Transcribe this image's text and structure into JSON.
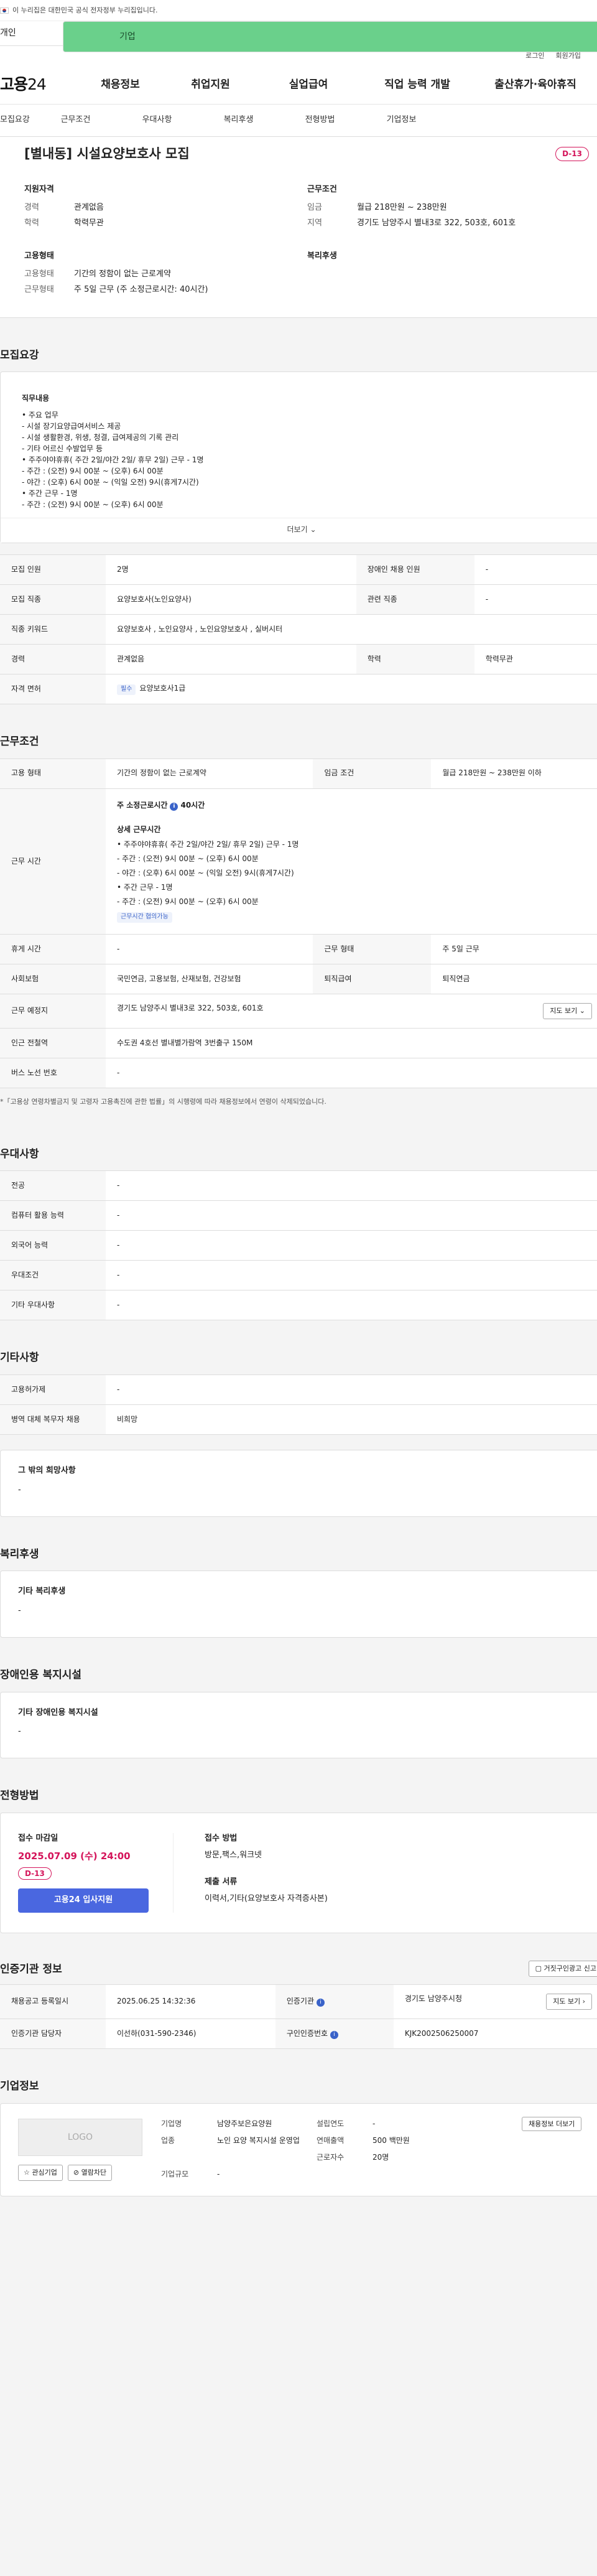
{
  "gov_banner": "이 누리집은 대한민국 공식 전자정부 누리집입니다.",
  "user_tabs": {
    "person": "개인",
    "company": "기업"
  },
  "util": {
    "login": "로그인",
    "signup": "회원가입"
  },
  "gnb": {
    "logo_main": "고용",
    "logo_num": "24",
    "items": [
      "채용정보",
      "취업지원",
      "실업급여",
      "직업 능력 개발",
      "출산휴가·육아휴직"
    ]
  },
  "subtabs": [
    "모집요강",
    "근무조건",
    "우대사항",
    "복리후생",
    "전형방법",
    "기업정보"
  ],
  "summary": {
    "title": "[별내동] 시설요양보호사 모집",
    "dday": "D-13",
    "qual": {
      "label": "지원자격",
      "career_k": "경력",
      "career_v": "관계없음",
      "edu_k": "학력",
      "edu_v": "학력무관"
    },
    "cond": {
      "label": "근무조건",
      "wage_k": "임금",
      "wage_v": "월급 218만원 ~ 238만원",
      "area_k": "지역",
      "area_v": "경기도 남양주시 별내3로 322, 503호, 601호"
    },
    "emp": {
      "label": "고용형태",
      "type_k": "고용형태",
      "type_v": "기간의 정함이 없는 근로계약",
      "work_k": "근무형태",
      "work_v": "주 5일 근무 (주 소정근로시간: 40시간)"
    },
    "welfare": {
      "label": "복리후생"
    }
  },
  "recruit": {
    "title": "모집요강",
    "duty_title": "직무내용",
    "duty_lines": "• 주요 업무\n   - 시설 장기요양급여서비스 제공\n   - 시설 생활환경, 위생, 청결, 급여제공의 기록 관리\n   - 기타 어르신 수발업무 등\n• 주주야야휴휴( 주간 2일/야간 2일/ 휴무 2일) 근무 - 1명\n   - 주간 : (오전) 9시 00분 ~ (오후) 6시 00분\n   - 야간 : (오후) 6시 00분 ~ (익일 오전) 9시(휴게7시간)\n• 주간 근무 - 1명\n   - 주간 : (오전) 9시 00분 ~ (오후) 6시 00분",
    "more": "더보기",
    "rows": {
      "count_k": "모집 인원",
      "count_v": "2명",
      "disabled_k": "장애인 채용 인원",
      "disabled_v": "-",
      "job_k": "모집 직종",
      "job_v": "요양보호사(노인요양사)",
      "rel_k": "관련 직종",
      "rel_v": "-",
      "kw_k": "직종 키워드",
      "kw_v": "요양보호사 , 노인요양사 , 노인요양보호사 , 실버시터",
      "career_k": "경력",
      "career_v": "관계없음",
      "edu_k": "학력",
      "edu_v": "학력무관",
      "license_k": "자격 면허",
      "license_tag": "필수",
      "license_v": "요양보호사1급"
    }
  },
  "work": {
    "title": "근무조건",
    "type_k": "고용 형태",
    "type_v": "기간의 정함이 없는 근로계약",
    "wage_k": "임금 조건",
    "wage_v": "월급 218만원 ~ 238만원 이하",
    "hours_k": "근무 시간",
    "hours_head": "주 소정근로시간",
    "hours_val": "40시간",
    "detail_title": "상세 근무시간",
    "detail_lines": "• 주주야야휴휴( 주간 2일/야간 2일/ 휴무 2일) 근무 - 1명\n      - 주간 : (오전) 9시 00분 ~ (오후) 6시 00분\n      - 야간 : (오후) 6시 00분 ~ (익일 오전) 9시(휴게7시간)\n• 주간 근무 - 1명\n      - 주간 : (오전) 9시 00분 ~ (오후) 6시 00분",
    "flex_tag": "근무시간 협의가능",
    "break_k": "휴게 시간",
    "break_v": "-",
    "form_k": "근무 형태",
    "form_v": "주 5일 근무",
    "ins_k": "사회보험",
    "ins_v": "국민연금, 고용보험, 산재보험, 건강보험",
    "pension_k": "퇴직급여",
    "pension_v": "퇴직연금",
    "place_k": "근무 예정지",
    "place_v": "경기도 남양주시 별내3로 322, 503호, 601호",
    "map_btn": "지도 보기",
    "subway_k": "인근 전철역",
    "subway_v": "수도권 4호선 별내별가람역 3번출구 150M",
    "bus_k": "버스 노선 번호",
    "bus_v": "-",
    "note": "*「고용상 연령차별금지 및 고령자 고용촉진에 관한 법률」의 시행령에 따라 채용정보에서 연령이 삭제되었습니다."
  },
  "pref": {
    "title": "우대사항",
    "rows": [
      [
        "전공",
        "-"
      ],
      [
        "컴퓨터 활용 능력",
        "-"
      ],
      [
        "외국어 능력",
        "-"
      ],
      [
        "우대조건",
        "-"
      ],
      [
        "기타 우대사항",
        "-"
      ]
    ]
  },
  "etc": {
    "title": "기타사항",
    "rows": [
      [
        "고용허가제",
        "-"
      ],
      [
        "병역 대체 복무자 채용",
        "비희망"
      ]
    ],
    "hope_title": "그 밖의 희망사항",
    "hope_v": "-"
  },
  "benefit": {
    "title": "복리후생",
    "sub": "기타 복리후생",
    "v": "-"
  },
  "facility": {
    "title": "장애인용 복지시설",
    "sub": "기타 장애인용 복지시설",
    "v": "-"
  },
  "method": {
    "title": "전형방법",
    "deadline_label": "접수 마감일",
    "deadline": "2025.07.09 (수) 24:00",
    "dday": "D-13",
    "apply_btn": "고용24 입사지원",
    "how_label": "접수 방법",
    "how_v": "방문,팩스,워크넷",
    "docs_label": "제출 서류",
    "docs_v": "이력서,기타(요양보호사 자격증사본)"
  },
  "agency": {
    "title": "인증기관 정보",
    "report_btn": "거짓구인광고 신고",
    "reg_k": "채용공고 등록일시",
    "reg_v": "2025.06.25 14:32:36",
    "org_k": "인증기관",
    "org_v": "경기도 남양주시청",
    "map_btn": "지도 보기",
    "mgr_k": "인증기관 담당자",
    "mgr_v": "이선하(031-590-2346)",
    "no_k": "구인인증번호",
    "no_v": "KJK2002506250007"
  },
  "company": {
    "title": "기업정보",
    "logo": "LOGO",
    "fav_btn": "관심기업",
    "block_btn": "열람차단",
    "name_k": "기업명",
    "name_v": "남양주보은요양원",
    "year_k": "설립연도",
    "year_v": "-",
    "ind_k": "업종",
    "ind_v": "노인 요양 복지시설 운영업",
    "sales_k": "연매출액",
    "sales_v": "500 백만원",
    "emp_k": "근로자수",
    "emp_v": "20명",
    "scale_k": "기업규모",
    "scale_v": "-",
    "more_btn": "채용정보 더보기"
  }
}
